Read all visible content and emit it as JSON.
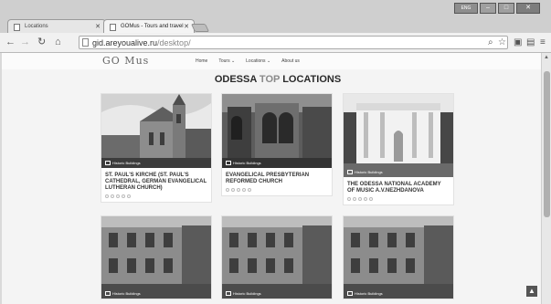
{
  "browser": {
    "tabs": [
      {
        "label": "Locations"
      },
      {
        "label": "GOMus - Tours and travel"
      }
    ],
    "address": {
      "host": "gid.areyoualive.ru",
      "path": "/desktop/"
    },
    "window_lang": "ENG"
  },
  "site": {
    "logo": "GO Mus",
    "nav": [
      "Home",
      "Tours ⌄",
      "Locations ⌄",
      "About us"
    ]
  },
  "page": {
    "heading_a": "ODESSA",
    "heading_b": "TOP",
    "heading_c": "LOCATIONS",
    "cards": [
      {
        "badge": "Historic Buildings",
        "title": "St. Paul's Kirche (St. Paul's Cathedral, German Evangelical Lutheran Church)"
      },
      {
        "badge": "Historic Buildings",
        "title": "Evangelical Presbyterian Reformed Church"
      },
      {
        "badge": "Historic Buildings",
        "title": "The Odessa National Academy of Music A.V.Nezhdanova"
      },
      {
        "badge": "Historic Buildings",
        "title": ""
      },
      {
        "badge": "Historic Buildings",
        "title": ""
      },
      {
        "badge": "Historic Buildings",
        "title": ""
      }
    ]
  },
  "colors": {
    "accent": "#8a8a8a",
    "heading": "#2a2a2a"
  }
}
